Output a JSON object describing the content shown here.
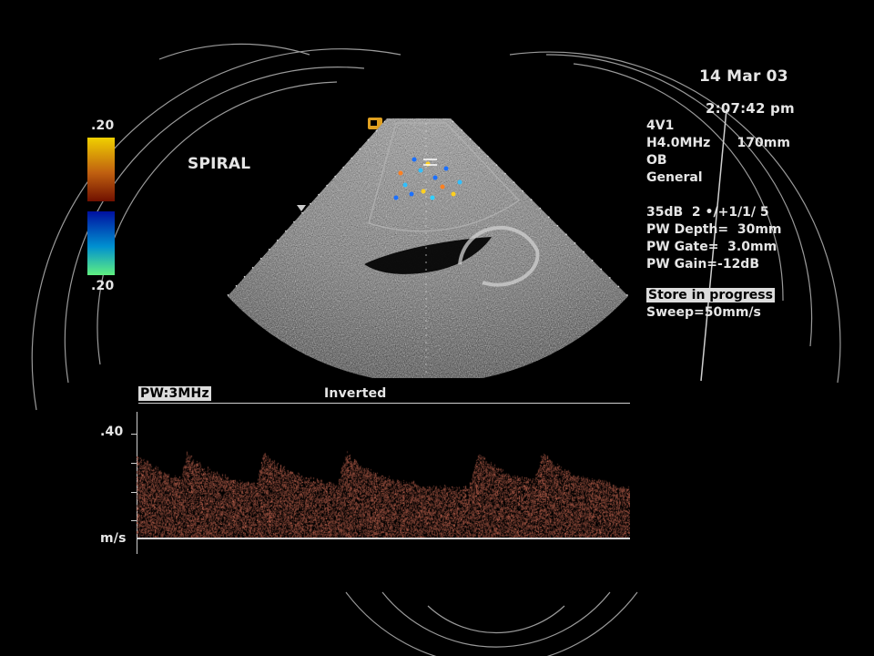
{
  "header": {
    "date": "14 Mar 03",
    "time": "2:07:42 pm"
  },
  "color_scale": {
    "top_value": ".20",
    "bottom_value": ".20",
    "positive_colors": [
      "#f0d000",
      "#c06010",
      "#701000"
    ],
    "negative_colors": [
      "#0010a0",
      "#0090d0",
      "#60f080"
    ]
  },
  "mode_label": "SPIRAL",
  "probe_marker": "probe-orientation-icon",
  "settings": {
    "lines": [
      {
        "id": "probe",
        "text": "4V1"
      },
      {
        "id": "frequency",
        "text": "H4.0MHz      170mm"
      },
      {
        "id": "exam",
        "text": "OB"
      },
      {
        "id": "preset",
        "text": "General"
      },
      {
        "id": "spacer",
        "text": ""
      },
      {
        "id": "gain",
        "text": "35dB  2 •/+1/1/ 5"
      },
      {
        "id": "pw_depth",
        "text": "PW Depth=  30mm"
      },
      {
        "id": "pw_gate",
        "text": "PW Gate=  3.0mm"
      },
      {
        "id": "pw_gain",
        "text": "PW Gain=-12dB"
      }
    ],
    "status": "Store in progress",
    "sweep": "Sweep=50mm/s"
  },
  "doppler": {
    "mode": "PW:3MHz",
    "orientation": "Inverted",
    "scale_top": ".40",
    "unit": "m/s",
    "spectrum_color": "#e07860"
  }
}
